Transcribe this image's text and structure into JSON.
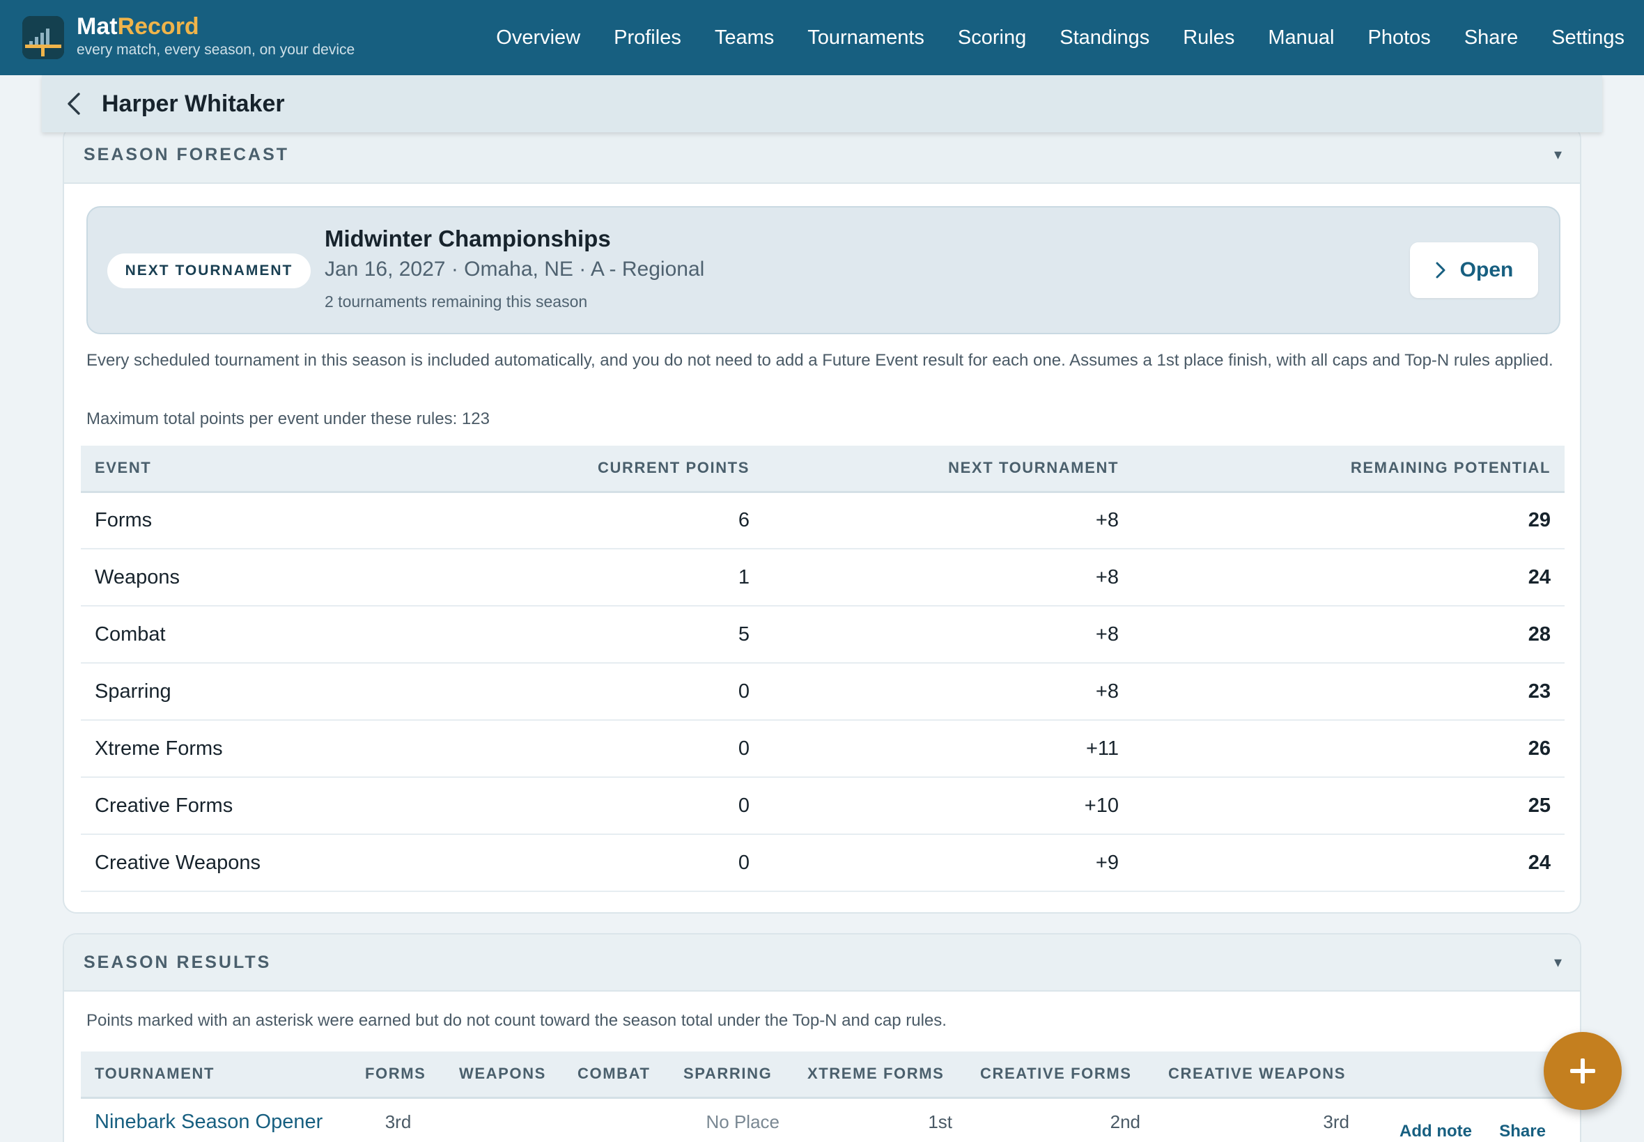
{
  "app": {
    "brand_main": "Mat",
    "brand_accent": "Record",
    "tagline": "every match, every season, on your device",
    "colors": {
      "header": "#175f80",
      "accent": "#f0b44a",
      "fab": "#c47f1f"
    }
  },
  "nav": [
    "Overview",
    "Profiles",
    "Teams",
    "Tournaments",
    "Scoring",
    "Standings",
    "Rules",
    "Manual",
    "Photos",
    "Share",
    "Settings"
  ],
  "page": {
    "title": "Harper Whitaker",
    "back_icon": "chevron-left-icon"
  },
  "forecast": {
    "heading": "SEASON FORECAST",
    "caret": "▾",
    "pill": "NEXT TOURNAMENT",
    "tournament_name": "Midwinter Championships",
    "tournament_meta": "Jan 16, 2027 · Omaha, NE · A - Regional",
    "remaining": "2 tournaments remaining this season",
    "open_label": "Open",
    "note": "Every scheduled tournament in this season is included automatically, and you do not need to add a Future Event result for each one. Assumes a 1st place finish, with all caps and Top-N rules applied.",
    "max_note": "Maximum total points per event under these rules: 123",
    "columns": [
      "EVENT",
      "CURRENT POINTS",
      "NEXT TOURNAMENT",
      "REMAINING POTENTIAL"
    ],
    "rows": [
      {
        "event": "Forms",
        "current": "6",
        "next": "+8",
        "potential": "29"
      },
      {
        "event": "Weapons",
        "current": "1",
        "next": "+8",
        "potential": "24"
      },
      {
        "event": "Combat",
        "current": "5",
        "next": "+8",
        "potential": "28"
      },
      {
        "event": "Sparring",
        "current": "0",
        "next": "+8",
        "potential": "23"
      },
      {
        "event": "Xtreme Forms",
        "current": "0",
        "next": "+11",
        "potential": "26"
      },
      {
        "event": "Creative Forms",
        "current": "0",
        "next": "+10",
        "potential": "25"
      },
      {
        "event": "Creative Weapons",
        "current": "0",
        "next": "+9",
        "potential": "24"
      }
    ]
  },
  "results": {
    "heading": "SEASON RESULTS",
    "caret": "▾",
    "note": "Points marked with an asterisk were earned but do not count toward the season total under the Top-N and cap rules.",
    "columns": [
      "TOURNAMENT",
      "FORMS",
      "WEAPONS",
      "COMBAT",
      "SPARRING",
      "XTREME FORMS",
      "CREATIVE FORMS",
      "CREATIVE WEAPONS"
    ],
    "rows": [
      {
        "tournament": "Ninebark Season Opener",
        "forms": "3rd",
        "weapons": "",
        "combat": "",
        "sparring": "No Place",
        "xtreme": "1st",
        "creative_forms": "2nd",
        "creative_weapons": "3rd",
        "add_note": "Add note",
        "share": "Share"
      }
    ]
  },
  "fab": {
    "icon": "plus-icon"
  }
}
